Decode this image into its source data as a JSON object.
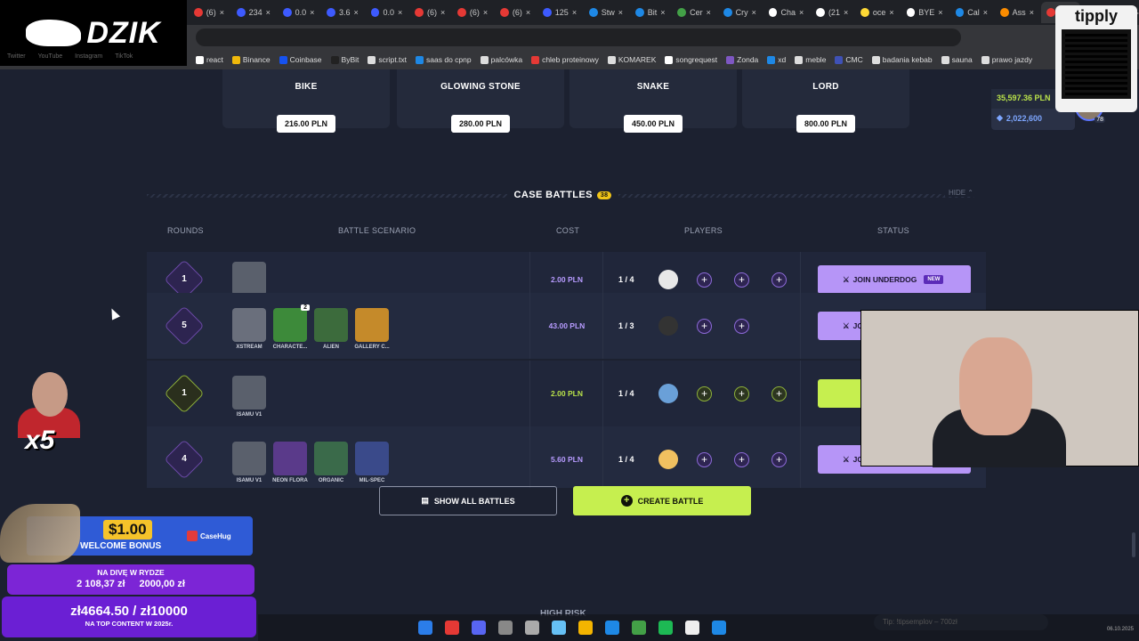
{
  "browser": {
    "tabs": [
      {
        "label": "(6)",
        "color": "#e53935",
        "active": false
      },
      {
        "label": "234",
        "color": "#3d5afe",
        "active": false
      },
      {
        "label": "0.0",
        "color": "#3d5afe",
        "active": false
      },
      {
        "label": "3.6",
        "color": "#3d5afe",
        "active": false
      },
      {
        "label": "0.0",
        "color": "#3d5afe",
        "active": false
      },
      {
        "label": "(6)",
        "color": "#e53935",
        "active": false
      },
      {
        "label": "(6)",
        "color": "#e53935",
        "active": false
      },
      {
        "label": "(6)",
        "color": "#e53935",
        "active": false
      },
      {
        "label": "125",
        "color": "#3d5afe",
        "active": false
      },
      {
        "label": "Stw",
        "color": "#1e88e5",
        "active": false
      },
      {
        "label": "Bit",
        "color": "#1e88e5",
        "active": false
      },
      {
        "label": "Cer",
        "color": "#43a047",
        "active": false
      },
      {
        "label": "Cry",
        "color": "#1e88e5",
        "active": false
      },
      {
        "label": "Cha",
        "color": "#ffffff",
        "active": false
      },
      {
        "label": "(21",
        "color": "#ffffff",
        "active": false
      },
      {
        "label": "oce",
        "color": "#fdd835",
        "active": false
      },
      {
        "label": "BYE",
        "color": "#ffffff",
        "active": false
      },
      {
        "label": "Cal",
        "color": "#1e88e5",
        "active": false
      },
      {
        "label": "Ass",
        "color": "#fb8c00",
        "active": false
      },
      {
        "label": "",
        "color": "#e53935",
        "active": true
      },
      {
        "label": "Tw",
        "color": "#e53935",
        "active": false
      }
    ],
    "new_tab": "+",
    "bookmarks": [
      {
        "label": "react",
        "color": "#fff"
      },
      {
        "label": "Binance",
        "color": "#f0b90b"
      },
      {
        "label": "Coinbase",
        "color": "#1652f0"
      },
      {
        "label": "ByBit",
        "color": "#222"
      },
      {
        "label": "script.txt",
        "color": "#ddd"
      },
      {
        "label": "saas do cpnp",
        "color": "#1e88e5"
      },
      {
        "label": "palcówka",
        "color": "#ddd"
      },
      {
        "label": "chleb proteinowy",
        "color": "#e53935"
      },
      {
        "label": "KOMAREK",
        "color": "#ddd"
      },
      {
        "label": "songrequest",
        "color": "#fff"
      },
      {
        "label": "Zonda",
        "color": "#7e57c2"
      },
      {
        "label": "xd",
        "color": "#1e88e5"
      },
      {
        "label": "meble",
        "color": "#ddd"
      },
      {
        "label": "CMC",
        "color": "#3f51b5"
      },
      {
        "label": "badania kebab",
        "color": "#ddd"
      },
      {
        "label": "sauna",
        "color": "#ddd"
      },
      {
        "label": "prawo jazdy",
        "color": "#ddd"
      }
    ]
  },
  "stream": {
    "logo": "DZIK",
    "social": [
      "Twitter",
      "YouTube",
      "Instagram",
      "TikTok"
    ],
    "tipply": "tipply",
    "x5": "x5",
    "promo": {
      "amount": "$1.00",
      "text": "WELCOME BONUS",
      "brand": "CaseHug"
    },
    "goal1": {
      "title": "NA DIVĘ W RYDZE",
      "current": "2 108,37 zł",
      "target": "2000,00 zł"
    },
    "goal2": {
      "value": "zł4664.50 / zł10000",
      "title": "NA TOP CONTENT W 2025r."
    },
    "tts": "Tip: !tipsemplov – 700zł",
    "date": "06.10.2025"
  },
  "prizes": [
    {
      "name": "BIKE",
      "price": "216.00 PLN"
    },
    {
      "name": "GLOWING STONE",
      "price": "280.00 PLN"
    },
    {
      "name": "SNAKE",
      "price": "450.00 PLN"
    },
    {
      "name": "LORD",
      "price": "800.00 PLN"
    }
  ],
  "account": {
    "balance": "35,597.36 PLN",
    "points": "2,022,600",
    "level": "78"
  },
  "case_battles": {
    "title": "CASE BATTLES",
    "count": "38",
    "hide": "HIDE",
    "columns": {
      "rounds": "ROUNDS",
      "scenario": "BATTLE SCENARIO",
      "cost": "COST",
      "players": "PLAYERS",
      "status": "STATUS"
    },
    "rows": [
      {
        "rounds": "1",
        "cases": [
          {
            "name": "ISAMU V1",
            "count": ""
          }
        ],
        "cost": "2.00 PLN",
        "players": "1 / 4",
        "slots": 3,
        "status": "JOIN UNDERDOG",
        "badge": "NEW",
        "variant": "purple"
      },
      {
        "rounds": "5",
        "cases": [
          {
            "name": "XSTREAM",
            "count": ""
          },
          {
            "name": "CHARACTE...",
            "count": "2"
          },
          {
            "name": "ALIEN",
            "count": ""
          },
          {
            "name": "GALLERY C...",
            "count": ""
          }
        ],
        "cost": "43.00 PLN",
        "players": "1 / 3",
        "slots": 2,
        "status": "JO",
        "badge": "",
        "variant": "purple"
      },
      {
        "rounds": "1",
        "cases": [
          {
            "name": "ISAMU V1",
            "count": ""
          }
        ],
        "cost": "2.00 PLN",
        "players": "1 / 4",
        "slots": 3,
        "status": "",
        "badge": "",
        "variant": "green"
      },
      {
        "rounds": "4",
        "cases": [
          {
            "name": "ISAMU V1",
            "count": ""
          },
          {
            "name": "NEON FLORA",
            "count": ""
          },
          {
            "name": "ORGANIC",
            "count": ""
          },
          {
            "name": "MIL-SPEC",
            "count": ""
          }
        ],
        "cost": "5.60 PLN",
        "players": "1 / 4",
        "slots": 3,
        "status": "JO",
        "badge": "",
        "variant": "purple"
      }
    ],
    "show_all": "SHOW ALL BATTLES",
    "create": "CREATE BATTLE"
  },
  "next_section": "HIGH RISK"
}
